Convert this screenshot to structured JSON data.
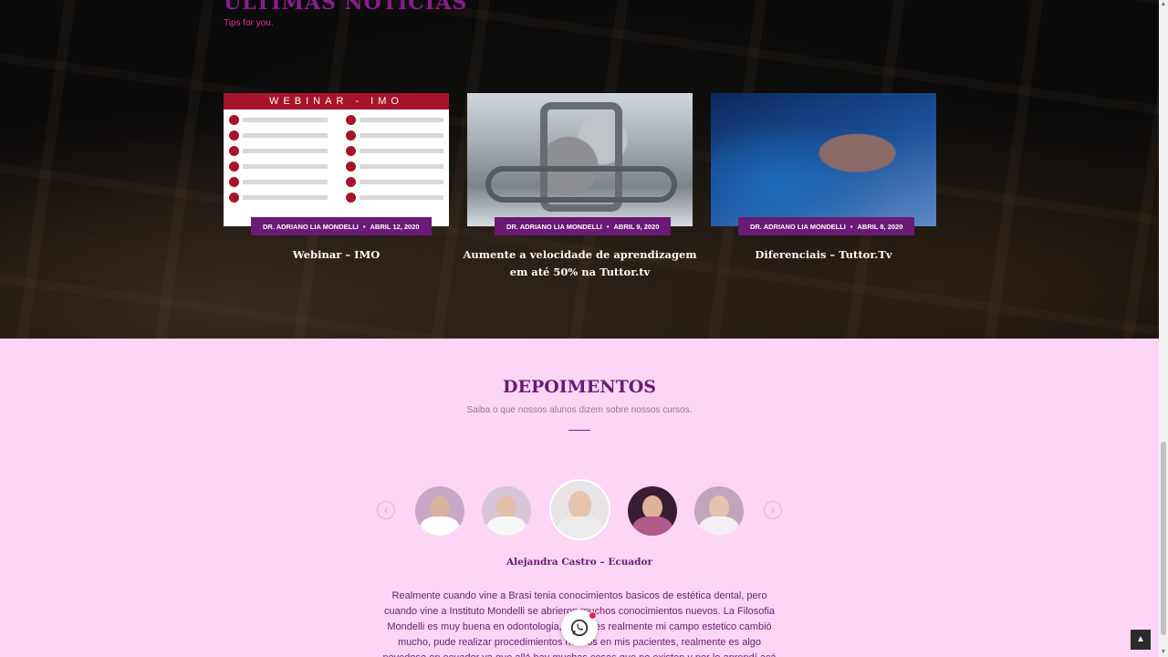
{
  "news": {
    "title": "ULTIMAS NOTICIAS",
    "subtitle": "Tips for you.",
    "cards": [
      {
        "author": "DR. ADRIANO LIA MONDELLI",
        "date": "ABRIL 12, 2020",
        "title": "Webinar – IMO",
        "image": "webinar-poster",
        "banner": "WEBINAR - IMO"
      },
      {
        "author": "DR. ADRIANO LIA MONDELLI",
        "date": "ABRIL 9, 2020",
        "title": "Aumente a velocidade de aprendizagem em até 50% na Tuttor.tv",
        "image": "engine-photo"
      },
      {
        "author": "DR. ADRIANO LIA MONDELLI",
        "date": "ABRIL 8, 2020",
        "title": "Diferenciais – Tuttor.Tv",
        "image": "hand-touchscreen-photo"
      }
    ]
  },
  "testimonials": {
    "title": "DEPOIMENTOS",
    "subtitle": "Saiba o que nossos alunos dizem sobre nossos cursos.",
    "active_name": "Alejandra Castro – Ecuador",
    "quote": "Realmente cuando vine a Brasi tenia conocimientos basicos de estética dental, pero cuando vine a Instituto Mondelli se abrieron muchos conocimientos nuevos. La Filosofia Mondelli es muy buena en odontologia, entonces realmente mi campo estetico cambió mucho, pude realizar procedimientos nuevos en mis pacientes, realmente es algo novedoso en ecuador ya que allá hay muchas cosas que no existen y por lo aprendí acá en Brasil.",
    "avatars": [
      "student-1",
      "student-2",
      "student-3-active",
      "student-4",
      "student-5"
    ],
    "prev_icon": "‹",
    "next_icon": "›"
  },
  "floating": {
    "whatsapp_icon": "whatsapp-icon",
    "back_to_top": "▲"
  },
  "colors": {
    "accent": "#6b1a75",
    "title_pink": "#8a1c8e",
    "background_pink": "#fcd6f4"
  }
}
